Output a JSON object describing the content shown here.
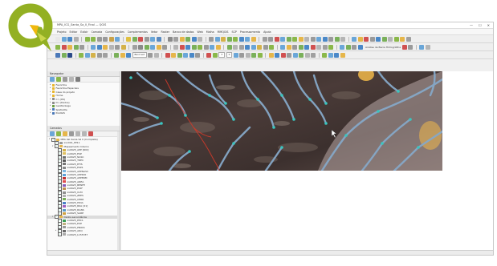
{
  "window": {
    "title": "MPA_ICG_Santa_Sa_II_Final — QGIS",
    "controls": [
      "—",
      "☐",
      "✕"
    ]
  },
  "menu": [
    "Projeto",
    "Editar",
    "Exibir",
    "Camada",
    "Configurações",
    "Complementos",
    "Vetor",
    "Raster",
    "Banco de dados",
    "Web",
    "Malha",
    "MMQGIS",
    "SCP",
    "Processamento",
    "Ajuda"
  ],
  "toolbar": {
    "profile_label": "Análise de Bacia Hidrográfica"
  },
  "toolbar3": {
    "combo1": "Band set",
    "combo2": "3",
    "combo3": "0"
  },
  "browser": {
    "title": "Navegador",
    "items": [
      {
        "label": "Favoritos",
        "color": "#e8b62c"
      },
      {
        "label": "Favoritos Espaciais",
        "color": "#e8b62c"
      },
      {
        "label": "Casa do projeto",
        "color": "#e8b62c"
      },
      {
        "label": "Home",
        "color": "#e8b62c"
      },
      {
        "label": "C:\\ (OS)",
        "color": "#8a8a8a"
      },
      {
        "label": "D:\\ (Dados)",
        "color": "#8a8a8a"
      },
      {
        "label": "GeoPackage",
        "color": "#6b9e3f"
      },
      {
        "label": "Spatialite",
        "color": "#4a78b8"
      },
      {
        "label": "PostGIS",
        "color": "#4a78b8"
      }
    ]
  },
  "layers": {
    "title": "Camadas",
    "items": [
      {
        "label": "MPA Val Xenia Sé II (Completa)",
        "level": 0,
        "arrow": "▾",
        "sym": "group"
      },
      {
        "label": "xxx001_PP11",
        "level": 1,
        "arrow": "",
        "sym": "#9a9a9a"
      },
      {
        "label": "Mapeamento Interno",
        "level": 1,
        "arrow": "▾",
        "sym": "group"
      },
      {
        "label": "xx0625_APP [RIO]",
        "level": 2,
        "arrow": "",
        "sym": "#d4b24a"
      },
      {
        "label": "xx0625_ESP",
        "level": 2,
        "arrow": "",
        "sym": "#e0c060"
      },
      {
        "label": "xx0625_NASC",
        "level": 2,
        "arrow": "",
        "sym": "#6f6f6f"
      },
      {
        "label": "xx0625_TREC",
        "level": 2,
        "arrow": "",
        "sym": "#5a5a5a"
      },
      {
        "label": "xx0625_EFIS",
        "level": 2,
        "arrow": "",
        "sym": "#777"
      },
      {
        "label": "xx0625_ESP1",
        "level": 2,
        "arrow": "",
        "sym": "#888"
      },
      {
        "label": "xx0625_APPNASC",
        "level": 2,
        "arrow": "",
        "sym": "#7cb8e0"
      },
      {
        "label": "xx0625_APPRIO",
        "level": 2,
        "arrow": "",
        "sym": "#5aa0d8"
      },
      {
        "label": "xx0625_APPERM",
        "level": 2,
        "arrow": "",
        "sym": "#c43030"
      },
      {
        "label": "xx0625_AREA",
        "level": 2,
        "arrow": "",
        "sym": "#e04a4a"
      },
      {
        "label": "xx0625_BENFE",
        "level": 2,
        "arrow": "",
        "sym": "#8a5ab8"
      },
      {
        "label": "xx0625_EDIF",
        "level": 2,
        "arrow": "",
        "sym": "#c09050"
      },
      {
        "label": "xx0625_CLM",
        "level": 2,
        "arrow": "",
        "sym": "#909090"
      },
      {
        "label": "xx0625_ZEES",
        "level": 2,
        "arrow": "",
        "sym": "#b0b0b0"
      },
      {
        "label": "xx0625_CERR",
        "level": 2,
        "arrow": "",
        "sym": "#7ab05a"
      },
      {
        "label": "xx0625_HIDA",
        "level": 2,
        "arrow": "",
        "sym": "#4a80c8"
      },
      {
        "label": "xx0625_RKA [21]",
        "level": 2,
        "arrow": "",
        "sym": "#a060c0"
      },
      {
        "label": "xx0625_RGNS",
        "level": 2,
        "arrow": "",
        "sym": "#5a9ac8"
      },
      {
        "label": "xx0625_SARE",
        "level": 2,
        "arrow": "",
        "sym": "#d0a040"
      },
      {
        "label": "Dados secundários",
        "level": 1,
        "arrow": "▾",
        "sym": "group"
      },
      {
        "label": "xx0625_PPC1",
        "level": 2,
        "arrow": "",
        "sym": "#3aa058"
      },
      {
        "label": "xx0625_EXP",
        "level": 2,
        "arrow": "",
        "sym": "#c0b080"
      },
      {
        "label": "xx0625_PN001",
        "level": 2,
        "arrow": "",
        "sym": "#9a9a9a"
      },
      {
        "label": "xx0625_ARQ",
        "level": 2,
        "arrow": "▸",
        "sym": "#6a6a6a"
      },
      {
        "label": "xx0625_L155337",
        "level": 2,
        "arrow": "",
        "sym": "#aaaaaa"
      }
    ]
  },
  "icons": {
    "logo": "qgis-logo-icon",
    "colors": {
      "logo_green": "#93b023",
      "logo_yellow": "#f0b80e",
      "river": "#86a8c8",
      "node": "#39c6c0",
      "highlight": "#d03a2a",
      "terrain": "#3a2e2d"
    }
  }
}
